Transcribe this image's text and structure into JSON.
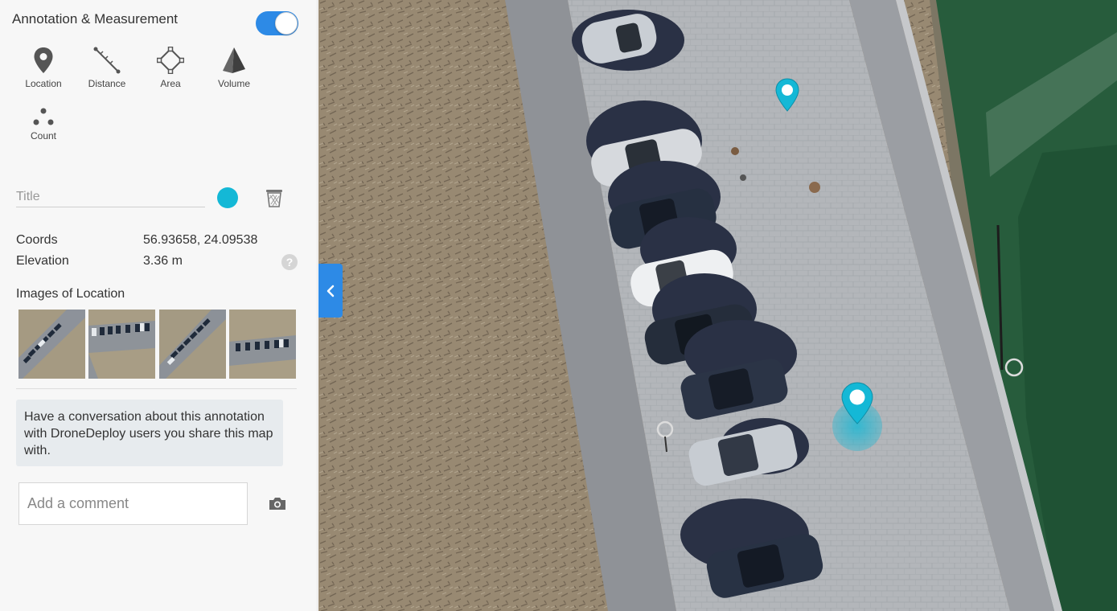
{
  "panel": {
    "title": "Annotation & Measurement",
    "toggle_on": true,
    "tools": [
      {
        "label": "Location",
        "icon": "location-pin-icon"
      },
      {
        "label": "Distance",
        "icon": "ruler-line-icon"
      },
      {
        "label": "Area",
        "icon": "polygon-area-icon"
      },
      {
        "label": "Volume",
        "icon": "pyramid-volume-icon"
      },
      {
        "label": "Count",
        "icon": "dots-count-icon"
      }
    ],
    "title_field": {
      "placeholder": "Title",
      "value": ""
    },
    "color": "#14b8d6",
    "coords_label": "Coords",
    "coords_value": "56.93658, 24.09538",
    "elevation_label": "Elevation",
    "elevation_value": "3.36 m",
    "images_title": "Images of Location",
    "conversation_text": "Have a conversation about this annotation with DroneDeploy users you share this map with.",
    "comment_placeholder": "Add a comment"
  },
  "colors": {
    "accent": "#2d8ae6",
    "marker": "#14b8d6"
  }
}
